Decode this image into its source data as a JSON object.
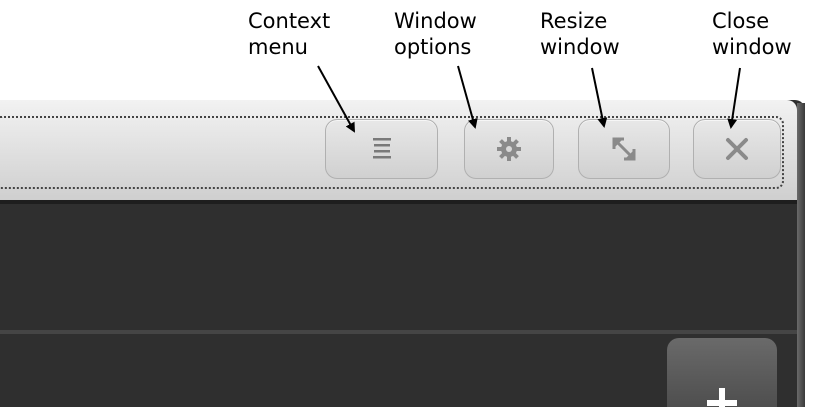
{
  "callouts": {
    "context_menu": {
      "line1": "Context",
      "line2": "menu"
    },
    "window_options": {
      "line1": "Window",
      "line2": "options"
    },
    "resize_window": {
      "line1": "Resize",
      "line2": "window"
    },
    "close_window": {
      "line1": "Close",
      "line2": "window"
    }
  },
  "titlebar": {
    "buttons": [
      {
        "name": "context-menu-button",
        "icon": "hamburger-menu-icon"
      },
      {
        "name": "window-options-button",
        "icon": "gear-icon"
      },
      {
        "name": "resize-window-button",
        "icon": "resize-diagonal-icon"
      },
      {
        "name": "close-window-button",
        "icon": "close-icon"
      }
    ]
  },
  "panel": {
    "add_button_icon": "plus-icon"
  },
  "colors": {
    "titlebar": "#e0e0e0",
    "window_body": "#2f2f2f",
    "icon_gray": "#8a8a8a",
    "arrow": "#000000"
  }
}
